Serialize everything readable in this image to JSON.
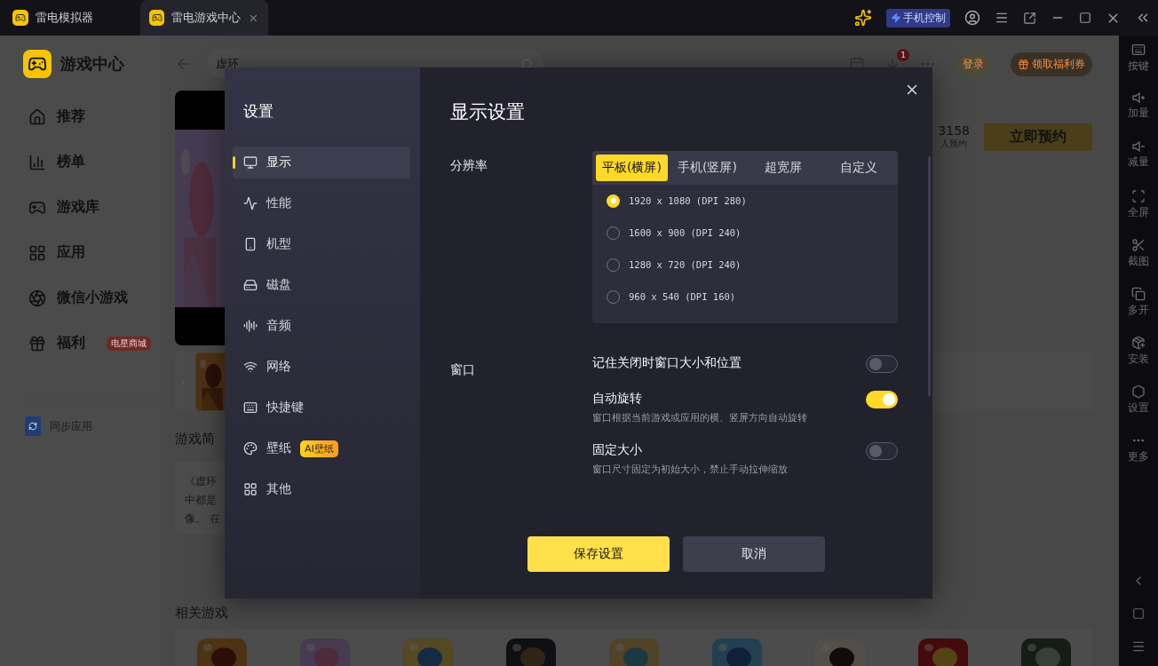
{
  "titlebar": {
    "app_title": "雷电模拟器",
    "tabs": [
      {
        "label": "雷电游戏中心",
        "selected": true
      }
    ],
    "phone_control": "手机控制"
  },
  "sidebar": {
    "title": "游戏中心",
    "items": [
      {
        "label": "推荐"
      },
      {
        "label": "榜单"
      },
      {
        "label": "游戏库"
      },
      {
        "label": "应用"
      },
      {
        "label": "微信小游戏"
      },
      {
        "label": "福利",
        "badge": "电星商城"
      }
    ],
    "sync": "同步应用"
  },
  "header": {
    "search_value": "虚环",
    "download_count": "1",
    "login": "登录",
    "coupon": "领取福利券"
  },
  "game": {
    "reserve_count": "3158",
    "reserve_label": "人预约",
    "reserve_button": "立即预约",
    "intro_title": "游戏简",
    "intro_lines": [
      "《虚环",
      "中都是",
      "像。 在"
    ],
    "related_title": "相关游戏",
    "related": [
      {
        "kind": "picture"
      },
      {
        "kind": "picture"
      },
      {
        "kind": "picture"
      },
      {
        "kind": "picture"
      },
      {
        "kind": "picture"
      },
      {
        "kind": "picture"
      },
      {
        "kind": "picture"
      },
      {
        "kind": "picture"
      },
      {
        "kind": "picture"
      }
    ]
  },
  "toolbar": [
    {
      "label": "按键"
    },
    {
      "label": "加量"
    },
    {
      "label": "减量"
    },
    {
      "label": "全屏"
    },
    {
      "label": "截图"
    },
    {
      "label": "多开"
    },
    {
      "label": "安装"
    },
    {
      "label": "设置"
    },
    {
      "label": "更多"
    }
  ],
  "dialog": {
    "title": "设置",
    "nav": [
      {
        "label": "显示",
        "selected": true
      },
      {
        "label": "性能",
        "selected": false
      },
      {
        "label": "机型",
        "selected": false
      },
      {
        "label": "磁盘",
        "selected": false
      },
      {
        "label": "音频",
        "selected": false
      },
      {
        "label": "网络",
        "selected": false
      },
      {
        "label": "快捷键",
        "selected": false
      },
      {
        "label": "壁纸",
        "selected": false,
        "badge": "AI壁纸"
      },
      {
        "label": "其他",
        "selected": false
      }
    ],
    "heading": "显示设置",
    "resolution": {
      "label": "分辨率",
      "tabs": [
        {
          "label": "平板(横屏)",
          "selected": true
        },
        {
          "label": "手机(竖屏)",
          "selected": false
        },
        {
          "label": "超宽屏",
          "selected": false
        },
        {
          "label": "自定义",
          "selected": false
        }
      ],
      "options": [
        {
          "label": "1920 x 1080 (DPI 280)",
          "selected": true
        },
        {
          "label": "1600 x 900 (DPI 240)",
          "selected": false
        },
        {
          "label": "1280 x 720 (DPI 240)",
          "selected": false
        },
        {
          "label": "960 x 540 (DPI 160)",
          "selected": false
        }
      ]
    },
    "window": {
      "label": "窗口",
      "settings": [
        {
          "label": "记住关闭时窗口大小和位置",
          "on": false
        },
        {
          "label": "自动旋转",
          "description": "窗口根据当前游戏或应用的横、竖屏方向自动旋转",
          "on": true
        },
        {
          "label": "固定大小",
          "description": "窗口尺寸固定为初始大小，禁止手动拉伸缩放",
          "on": false
        }
      ]
    },
    "save": "保存设置",
    "cancel": "取消"
  }
}
